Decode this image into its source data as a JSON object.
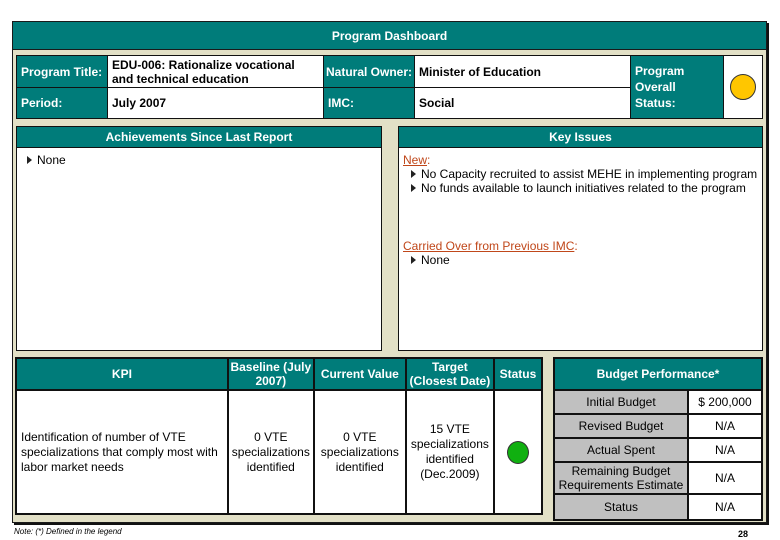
{
  "header": {
    "title": "Program Dashboard"
  },
  "info": {
    "program_title_label": "Program Title:",
    "program_title_value": "EDU-006: Rationalize vocational and technical education",
    "period_label": "Period:",
    "period_value": "July 2007",
    "natural_owner_label": "Natural Owner:",
    "natural_owner_value": "Minister of Education",
    "imc_label": "IMC:",
    "imc_value": "Social",
    "overall_status_label": "Program Overall Status:",
    "overall_status": "yellow",
    "overall_status_color": "#ffc600"
  },
  "achievements": {
    "title": "Achievements Since Last Report",
    "items": [
      "None"
    ]
  },
  "key_issues": {
    "title": "Key Issues",
    "new_label": "New",
    "new_items": [
      "No Capacity recruited to assist MEHE in implementing  program",
      "No funds available to launch initiatives related to the program"
    ],
    "carried_label": "Carried Over from Previous IMC",
    "carried_items": [
      "None"
    ]
  },
  "kpi_table": {
    "headers": [
      "KPI",
      "Baseline (July 2007)",
      "Current Value",
      "Target (Closest Date)",
      "Status"
    ],
    "rows": [
      {
        "kpi": "Identification of number of VTE specializations that comply most with labor market needs",
        "baseline": "0 VTE specializations identified",
        "current": "0 VTE specializations identified",
        "target": "15 VTE specializations identified (Dec.2009)",
        "status": "green",
        "status_color": "#10b010"
      }
    ]
  },
  "budget": {
    "title": "Budget Performance*",
    "rows": [
      {
        "label": "Initial Budget",
        "value": "$ 200,000"
      },
      {
        "label": "Revised Budget",
        "value": "N/A"
      },
      {
        "label": "Actual Spent",
        "value": "N/A"
      },
      {
        "label": "Remaining Budget Requirements Estimate",
        "value": "N/A"
      },
      {
        "label": "Status",
        "value": "N/A"
      }
    ]
  },
  "footer": {
    "note": "Note:  (*) Defined in the legend",
    "page_number": "28"
  },
  "colors": {
    "teal": "#007c7a",
    "panel_bg": "#e2e0c6",
    "subheading": "#c0471a"
  }
}
